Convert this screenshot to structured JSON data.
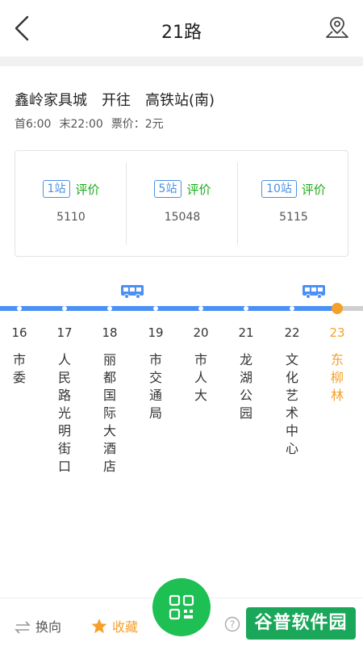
{
  "header": {
    "title": "21路"
  },
  "route": {
    "from": "鑫岭家具城",
    "direction": "开往",
    "to": "高铁站(南)"
  },
  "times": {
    "first": "首6:00",
    "last": "末22:00",
    "fare": "票价：2元"
  },
  "ratings": [
    {
      "badge": "1站",
      "label": "评价",
      "value": "5110"
    },
    {
      "badge": "5站",
      "label": "评价",
      "value": "15048"
    },
    {
      "badge": "10站",
      "label": "评价",
      "value": "5115"
    }
  ],
  "stops": [
    {
      "num": "16",
      "name": "市委"
    },
    {
      "num": "17",
      "name": "人民路光明街口"
    },
    {
      "num": "18",
      "name": "丽都国际大酒店"
    },
    {
      "num": "19",
      "name": "市交通局"
    },
    {
      "num": "20",
      "name": "市人大"
    },
    {
      "num": "21",
      "name": "龙湖公园"
    },
    {
      "num": "22",
      "name": "文化艺术中心"
    },
    {
      "num": "23",
      "name": "东柳林"
    }
  ],
  "current_stop": "23",
  "bottom": {
    "reverse": "换向",
    "favorite": "收藏",
    "help": "?"
  },
  "watermark": "谷普软件园",
  "colors": {
    "line": "#4a90f5",
    "current": "#f5a02a",
    "green": "#1aad19",
    "fab": "#1ebf53"
  },
  "icons": {
    "back": "chevron-left-icon",
    "map": "map-pin-icon",
    "bus": "bus-icon",
    "qr": "qr-code-icon",
    "reverse": "swap-icon",
    "favorite": "star-icon"
  }
}
